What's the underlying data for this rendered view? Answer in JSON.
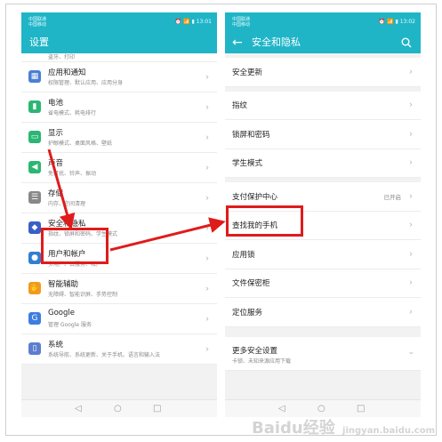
{
  "left_phone": {
    "status": {
      "carrier1": "中国联通",
      "carrier2": "中国移动",
      "right": "⏰ 📶 ▮ 13:01"
    },
    "title": "设置",
    "items": [
      {
        "title": "",
        "subtitle": "盗牙、打印",
        "icon": "bluetooth-icon",
        "color": "#7b8cde"
      },
      {
        "title": "应用和通知",
        "subtitle": "权限管理、默认应用、应用分身",
        "icon": "apps-icon",
        "color": "#4a7fd6"
      },
      {
        "title": "电池",
        "subtitle": "省电模式、耗电排行",
        "icon": "battery-icon",
        "color": "#2bb673"
      },
      {
        "title": "显示",
        "subtitle": "护眼模式、桌面风格、壁纸",
        "icon": "display-icon",
        "color": "#2bb673"
      },
      {
        "title": "声音",
        "subtitle": "免打扰、铃声、振动",
        "icon": "sound-icon",
        "color": "#2bb673"
      },
      {
        "title": "存储",
        "subtitle": "内存、空间清理",
        "icon": "storage-icon",
        "color": "#888888"
      },
      {
        "title": "安全和隐私",
        "subtitle": "指纹、锁屏和密码、学生模式",
        "icon": "shield-icon",
        "color": "#3a5fc6"
      },
      {
        "title": "用户和帐户",
        "subtitle": "多用户、云服务、帐户",
        "icon": "user-icon",
        "color": "#2f7fd4"
      },
      {
        "title": "智能辅助",
        "subtitle": "无障碍、智能识屏、手势控制",
        "icon": "hand-icon",
        "color": "#f29a1b"
      },
      {
        "title": "Google",
        "subtitle": "管理 Google 服务",
        "icon": "google-icon",
        "color": "#3d7de0"
      },
      {
        "title": "系统",
        "subtitle": "系统导航、系统更新、关于手机、语言和输入法",
        "icon": "phone-icon",
        "color": "#5c7ecf"
      }
    ]
  },
  "right_phone": {
    "status": {
      "carrier1": "中国联通",
      "carrier2": "中国移动",
      "right": "⏰ 📶 ▮ 13:02"
    },
    "title": "安全和隐私",
    "items": [
      {
        "title": "安全更新",
        "value": "",
        "subtitle": ""
      },
      {
        "title": "指纹",
        "value": "",
        "subtitle": ""
      },
      {
        "title": "锁屏和密码",
        "value": "",
        "subtitle": ""
      },
      {
        "title": "学生模式",
        "value": "",
        "subtitle": ""
      },
      {
        "title": "支付保护中心",
        "value": "已开启",
        "subtitle": ""
      },
      {
        "title": "查找我的手机",
        "value": "",
        "subtitle": ""
      },
      {
        "title": "应用锁",
        "value": "",
        "subtitle": ""
      },
      {
        "title": "文件保密柜",
        "value": "",
        "subtitle": ""
      },
      {
        "title": "定位服务",
        "value": "",
        "subtitle": ""
      },
      {
        "title": "更多安全设置",
        "value": "",
        "subtitle": "卡锁、未知来源应用下载"
      }
    ]
  },
  "nav": {
    "back": "◁",
    "home": "○",
    "recent": "□"
  },
  "watermark": {
    "text": "Baidu经验",
    "sub": "jingyan.baidu.com"
  },
  "colors": {
    "appbar": "#1fb5c7",
    "highlight": "#e01b1b"
  }
}
